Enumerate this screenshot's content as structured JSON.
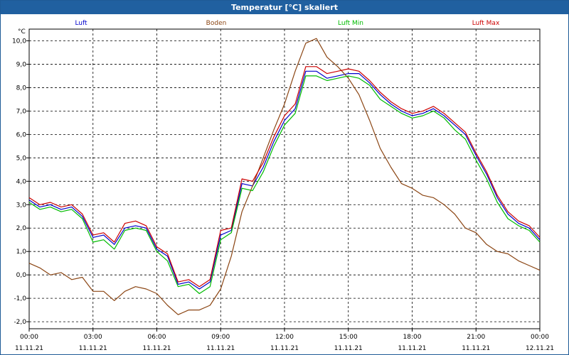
{
  "window": {
    "title": "Temperatur [°C] skaliert"
  },
  "chart_data": {
    "type": "line",
    "unit_label": "°C",
    "ylim": [
      -2.3,
      10.5
    ],
    "yticks": [
      -2,
      -1,
      0,
      1,
      2,
      3,
      4,
      5,
      6,
      7,
      8,
      9,
      10
    ],
    "ytick_labels": [
      "-2,0",
      "-1,0",
      "0,0",
      "1,0",
      "2,0",
      "3,0",
      "4,0",
      "5,0",
      "6,0",
      "7,0",
      "8,0",
      "9,0",
      "10,0"
    ],
    "xlim": [
      0,
      24
    ],
    "xticks": [
      0,
      3,
      6,
      9,
      12,
      15,
      18,
      21,
      24
    ],
    "xtick_time": [
      "00:00",
      "03:00",
      "06:00",
      "09:00",
      "12:00",
      "15:00",
      "18:00",
      "21:00",
      "00:00"
    ],
    "xtick_date": [
      "11.11.21",
      "11.11.21",
      "11.11.21",
      "11.11.21",
      "11.11.21",
      "11.11.21",
      "11.11.21",
      "11.11.21",
      "12.11.21"
    ],
    "grid": true,
    "series": [
      {
        "name": "Luft",
        "color": "#0000cc",
        "x": [
          0,
          0.5,
          1,
          1.5,
          2,
          2.5,
          3,
          3.5,
          4,
          4.5,
          5,
          5.5,
          6,
          6.5,
          7,
          7.5,
          8,
          8.5,
          9,
          9.5,
          10,
          10.5,
          11,
          11.5,
          12,
          12.5,
          13,
          13.5,
          14,
          14.5,
          15,
          15.5,
          16,
          16.5,
          17,
          17.5,
          18,
          18.5,
          19,
          19.5,
          20,
          20.5,
          21,
          21.5,
          22,
          22.5,
          23,
          23.5,
          24
        ],
        "y": [
          3.2,
          2.9,
          3.0,
          2.8,
          2.9,
          2.5,
          1.6,
          1.7,
          1.3,
          2.0,
          2.1,
          2.0,
          1.1,
          0.8,
          -0.4,
          -0.3,
          -0.6,
          -0.3,
          1.7,
          1.9,
          3.9,
          3.8,
          4.6,
          5.7,
          6.6,
          7.1,
          8.7,
          8.7,
          8.4,
          8.5,
          8.6,
          8.6,
          8.2,
          7.7,
          7.3,
          7.0,
          6.8,
          6.9,
          7.1,
          6.8,
          6.4,
          6.0,
          5.1,
          4.3,
          3.3,
          2.6,
          2.2,
          2.0,
          1.5
        ]
      },
      {
        "name": "Boden",
        "color": "#8b4513",
        "x": [
          0,
          0.5,
          1,
          1.5,
          2,
          2.5,
          3,
          3.5,
          4,
          4.5,
          5,
          5.5,
          6,
          6.5,
          7,
          7.5,
          8,
          8.5,
          9,
          9.5,
          10,
          10.5,
          11,
          11.5,
          12,
          12.5,
          13,
          13.5,
          14,
          14.5,
          15,
          15.5,
          16,
          16.5,
          17,
          17.5,
          18,
          18.5,
          19,
          19.5,
          20,
          20.5,
          21,
          21.5,
          22,
          22.5,
          23,
          23.5,
          24
        ],
        "y": [
          0.5,
          0.3,
          0.0,
          0.1,
          -0.2,
          -0.1,
          -0.7,
          -0.7,
          -1.1,
          -0.7,
          -0.5,
          -0.6,
          -0.8,
          -1.3,
          -1.7,
          -1.5,
          -1.5,
          -1.3,
          -0.6,
          0.8,
          2.7,
          3.8,
          5.0,
          6.2,
          7.3,
          8.7,
          9.9,
          10.1,
          9.3,
          8.9,
          8.4,
          7.7,
          6.6,
          5.4,
          4.6,
          3.9,
          3.7,
          3.4,
          3.3,
          3.0,
          2.6,
          2.0,
          1.8,
          1.3,
          1.0,
          0.9,
          0.6,
          0.4,
          0.2
        ]
      },
      {
        "name": "Luft Min",
        "color": "#00bb00",
        "x": [
          0,
          0.5,
          1,
          1.5,
          2,
          2.5,
          3,
          3.5,
          4,
          4.5,
          5,
          5.5,
          6,
          6.5,
          7,
          7.5,
          8,
          8.5,
          9,
          9.5,
          10,
          10.5,
          11,
          11.5,
          12,
          12.5,
          13,
          13.5,
          14,
          14.5,
          15,
          15.5,
          16,
          16.5,
          17,
          17.5,
          18,
          18.5,
          19,
          19.5,
          20,
          20.5,
          21,
          21.5,
          22,
          22.5,
          23,
          23.5,
          24
        ],
        "y": [
          3.1,
          2.8,
          2.9,
          2.7,
          2.8,
          2.4,
          1.4,
          1.5,
          1.1,
          1.9,
          2.0,
          1.9,
          1.0,
          0.6,
          -0.5,
          -0.4,
          -0.8,
          -0.5,
          1.5,
          1.8,
          3.7,
          3.6,
          4.4,
          5.5,
          6.4,
          6.9,
          8.5,
          8.5,
          8.3,
          8.4,
          8.5,
          8.4,
          8.1,
          7.5,
          7.2,
          6.9,
          6.7,
          6.8,
          7.0,
          6.7,
          6.2,
          5.8,
          4.9,
          4.1,
          3.1,
          2.4,
          2.1,
          1.9,
          1.4
        ]
      },
      {
        "name": "Luft Max",
        "color": "#cc0000",
        "x": [
          0,
          0.5,
          1,
          1.5,
          2,
          2.5,
          3,
          3.5,
          4,
          4.5,
          5,
          5.5,
          6,
          6.5,
          7,
          7.5,
          8,
          8.5,
          9,
          9.5,
          10,
          10.5,
          11,
          11.5,
          12,
          12.5,
          13,
          13.5,
          14,
          14.5,
          15,
          15.5,
          16,
          16.5,
          17,
          17.5,
          18,
          18.5,
          19,
          19.5,
          20,
          20.5,
          21,
          21.5,
          22,
          22.5,
          23,
          23.5,
          24
        ],
        "y": [
          3.3,
          3.0,
          3.1,
          2.9,
          3.0,
          2.6,
          1.7,
          1.8,
          1.4,
          2.2,
          2.3,
          2.1,
          1.2,
          0.9,
          -0.3,
          -0.2,
          -0.5,
          -0.2,
          1.9,
          2.0,
          4.1,
          4.0,
          4.8,
          5.9,
          6.8,
          7.3,
          8.9,
          8.9,
          8.6,
          8.7,
          8.8,
          8.7,
          8.3,
          7.8,
          7.4,
          7.1,
          6.9,
          7.0,
          7.2,
          6.9,
          6.5,
          6.1,
          5.2,
          4.4,
          3.4,
          2.7,
          2.3,
          2.1,
          1.6
        ]
      }
    ]
  }
}
